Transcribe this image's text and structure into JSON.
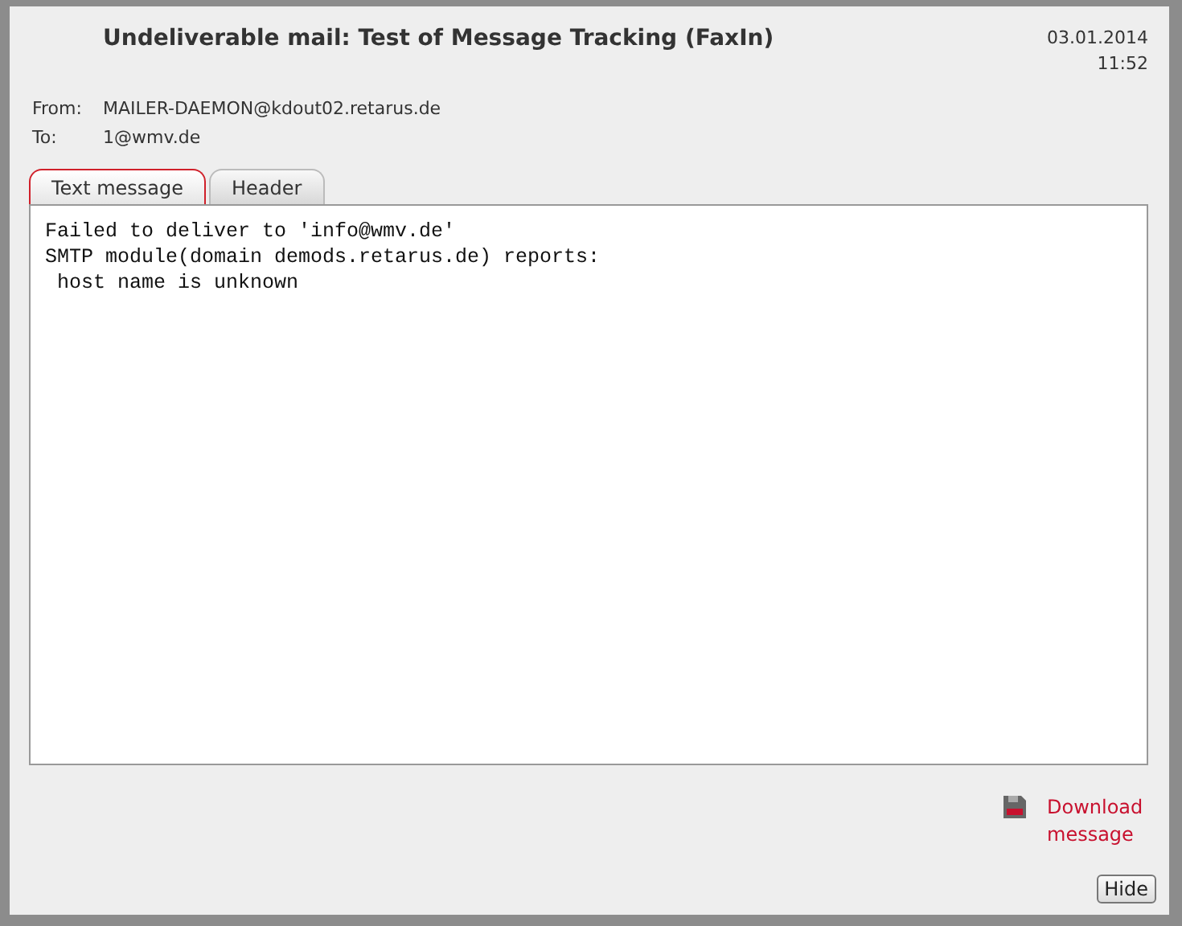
{
  "message": {
    "subject": "Undeliverable mail: Test of Message Tracking (FaxIn)",
    "date": "03.01.2014",
    "time": "11:52"
  },
  "fields": [
    {
      "label": "From:",
      "value": "MAILER-DAEMON@kdout02.retarus.de"
    },
    {
      "label": "To:",
      "value": "1@wmv.de"
    }
  ],
  "tabs": [
    {
      "label": "Text message",
      "selected": true
    },
    {
      "label": "Header",
      "selected": false
    }
  ],
  "body_lines": [
    "Failed to deliver to 'info@wmv.de'",
    "SMTP module(domain demods.retarus.de) reports:",
    " host name is unknown"
  ],
  "download": {
    "label": "Download message"
  },
  "buttons": [
    {
      "label": "Hide"
    }
  ]
}
